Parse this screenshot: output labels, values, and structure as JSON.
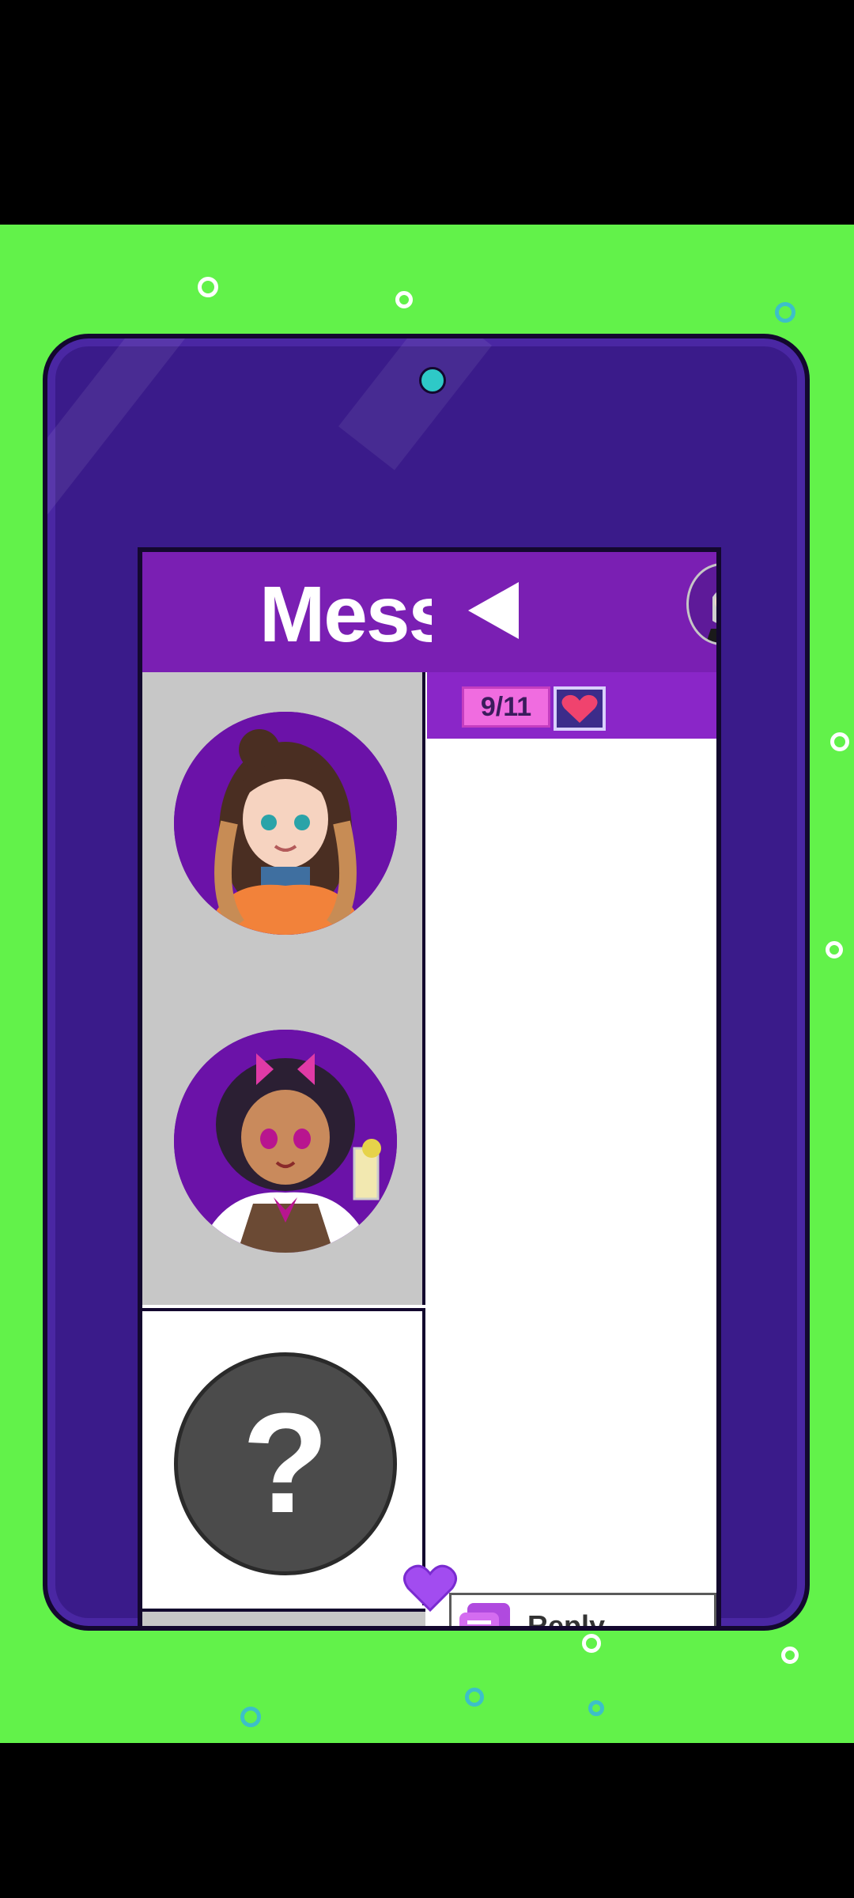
{
  "screen": {
    "title": "Mess",
    "counter": "9/11",
    "reply_placeholder": "Reply..."
  },
  "contacts": [
    {
      "name": "brunette-girl-avatar",
      "locked": false
    },
    {
      "name": "bartender-girl-avatar",
      "locked": false
    },
    {
      "name": "unknown-contact",
      "locked": true,
      "symbol": "?"
    }
  ],
  "colors": {
    "background": "#62f24a",
    "tablet": "#3a1b8a",
    "header": "#7a1fb3",
    "accent_pink": "#f06ce0"
  },
  "icons": [
    "back-arrow-icon",
    "heart-icon",
    "message-bubble-icon",
    "home-heart-icon"
  ]
}
